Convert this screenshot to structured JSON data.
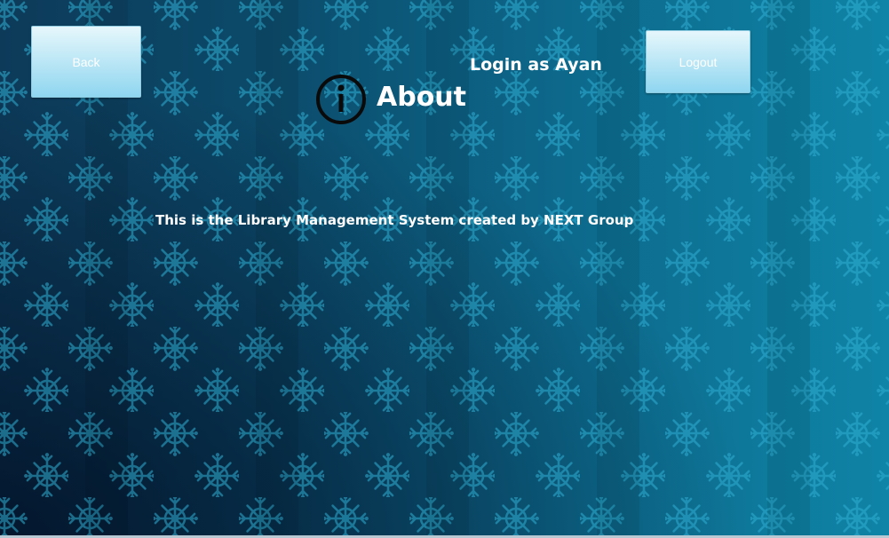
{
  "header": {
    "back_label": "Back",
    "logout_label": "Logout",
    "login_status": "Login as Ayan",
    "title": "About"
  },
  "icons": {
    "about_icon": "info-circle-icon"
  },
  "main": {
    "about_text": "This is the Library Management System created by NEXT Group"
  },
  "colors": {
    "background_dark": "#0d3a59",
    "background_light": "#0f84a6",
    "pattern": "#2eaed2",
    "button_top": "#e6f7fc",
    "button_bottom": "#8fd6f0",
    "text": "#ffffff"
  }
}
